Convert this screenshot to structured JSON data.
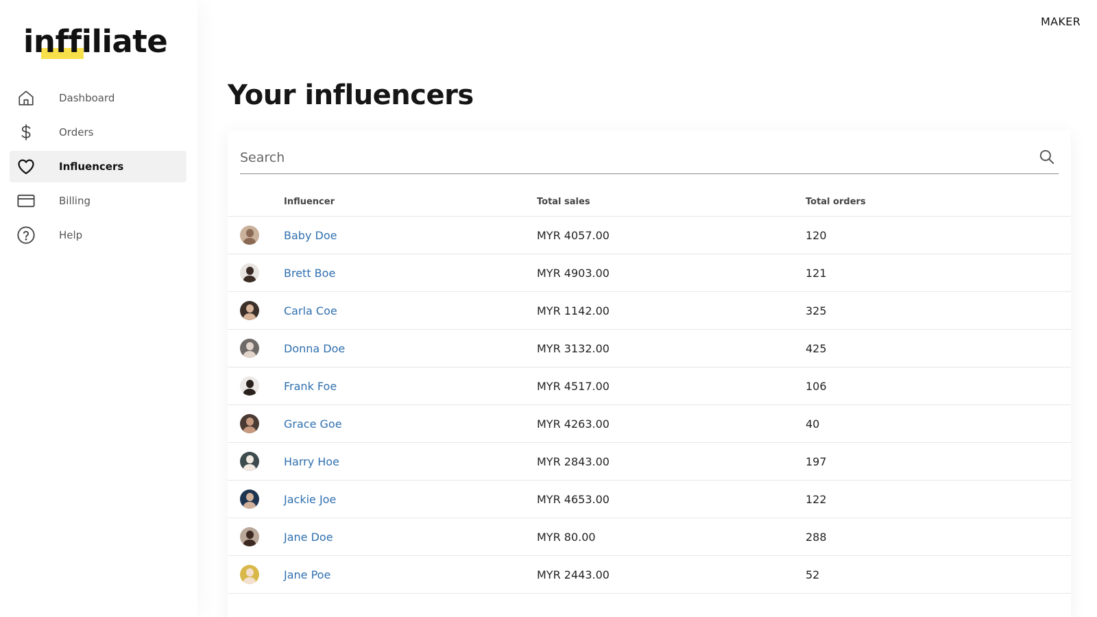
{
  "app": {
    "logo_text": "inffiliate",
    "role_label": "MAKER",
    "accent_color": "#f8e04a",
    "link_color": "#2f6fae"
  },
  "sidebar": {
    "items": [
      {
        "label": "Dashboard",
        "icon": "home-icon",
        "active": false
      },
      {
        "label": "Orders",
        "icon": "dollar-icon",
        "active": false
      },
      {
        "label": "Influencers",
        "icon": "heart-icon",
        "active": true
      },
      {
        "label": "Billing",
        "icon": "credit-card-icon",
        "active": false
      },
      {
        "label": "Help",
        "icon": "help-circle-icon",
        "active": false
      }
    ]
  },
  "main": {
    "title": "Your influencers",
    "search": {
      "placeholder": "Search",
      "value": ""
    },
    "table": {
      "columns": [
        "",
        "Influencer",
        "Total sales",
        "Total orders"
      ],
      "rows": [
        {
          "name": "Baby Doe",
          "sales": "MYR 4057.00",
          "orders": "120",
          "avatar_bg": "#c9b19b",
          "avatar_fg": "#8a6a55"
        },
        {
          "name": "Brett Boe",
          "sales": "MYR 4903.00",
          "orders": "121",
          "avatar_bg": "#e8e4e2",
          "avatar_fg": "#3a2b24"
        },
        {
          "name": "Carla Coe",
          "sales": "MYR 1142.00",
          "orders": "325",
          "avatar_bg": "#3b2f2a",
          "avatar_fg": "#d7b49a"
        },
        {
          "name": "Donna Doe",
          "sales": "MYR 3132.00",
          "orders": "425",
          "avatar_bg": "#6e6a68",
          "avatar_fg": "#e2d3cb"
        },
        {
          "name": "Frank Foe",
          "sales": "MYR 4517.00",
          "orders": "106",
          "avatar_bg": "#ece9e7",
          "avatar_fg": "#2a211d"
        },
        {
          "name": "Grace Goe",
          "sales": "MYR 4263.00",
          "orders": "40",
          "avatar_bg": "#4a3a34",
          "avatar_fg": "#c79a7f"
        },
        {
          "name": "Harry Hoe",
          "sales": "MYR 2843.00",
          "orders": "197",
          "avatar_bg": "#3d4a4e",
          "avatar_fg": "#f1e9e2"
        },
        {
          "name": "Jackie Joe",
          "sales": "MYR 4653.00",
          "orders": "122",
          "avatar_bg": "#1e3552",
          "avatar_fg": "#d2b19a"
        },
        {
          "name": "Jane Doe",
          "sales": "MYR 80.00",
          "orders": "288",
          "avatar_bg": "#b9a79a",
          "avatar_fg": "#3c2a22"
        },
        {
          "name": "Jane Poe",
          "sales": "MYR 2443.00",
          "orders": "52",
          "avatar_bg": "#d9b84a",
          "avatar_fg": "#f3e0cf"
        }
      ]
    }
  }
}
